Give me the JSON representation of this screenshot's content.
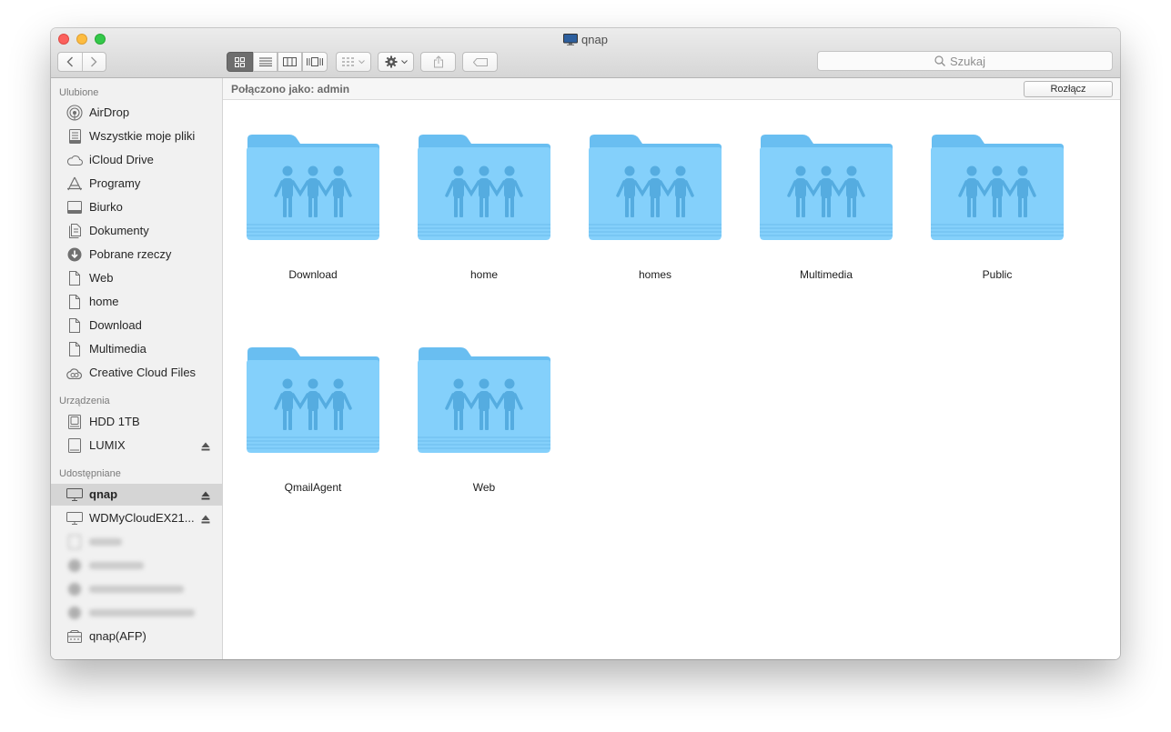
{
  "window": {
    "title": "qnap"
  },
  "toolbar": {
    "views": [
      "icon",
      "list",
      "column",
      "coverflow"
    ],
    "search_placeholder": "Szukaj"
  },
  "sidebar": {
    "sections": [
      {
        "heading": "Ulubione",
        "items": [
          {
            "label": "AirDrop",
            "icon": "airdrop-icon"
          },
          {
            "label": "Wszystkie moje pliki",
            "icon": "all-files-icon"
          },
          {
            "label": "iCloud Drive",
            "icon": "cloud-icon"
          },
          {
            "label": "Programy",
            "icon": "applications-icon"
          },
          {
            "label": "Biurko",
            "icon": "desktop-icon"
          },
          {
            "label": "Dokumenty",
            "icon": "documents-icon"
          },
          {
            "label": "Pobrane rzeczy",
            "icon": "download-icon"
          },
          {
            "label": "Web",
            "icon": "file-icon"
          },
          {
            "label": "home",
            "icon": "file-icon"
          },
          {
            "label": "Download",
            "icon": "file-icon"
          },
          {
            "label": "Multimedia",
            "icon": "file-icon"
          },
          {
            "label": "Creative Cloud Files",
            "icon": "creative-cloud-icon"
          }
        ]
      },
      {
        "heading": "Urządzenia",
        "items": [
          {
            "label": "HDD 1TB",
            "icon": "hard-drive-icon"
          },
          {
            "label": "LUMIX",
            "icon": "external-drive-icon",
            "eject": true
          }
        ]
      },
      {
        "heading": "Udostępniane",
        "items": [
          {
            "label": "qnap",
            "icon": "monitor-icon",
            "eject": true,
            "selected": true
          },
          {
            "label": "WDMyCloudEX21...",
            "icon": "monitor-icon",
            "eject": true
          },
          {
            "label": "qnap(AFP)",
            "icon": "server-icon"
          }
        ]
      }
    ]
  },
  "pathbar": {
    "connected_label": "Połączono jako: admin",
    "disconnect_label": "Rozłącz"
  },
  "folders": [
    "Download",
    "home",
    "homes",
    "Multimedia",
    "Public",
    "QmailAgent",
    "Web"
  ],
  "colors": {
    "folder_back": "#6cc3f3",
    "folder_front": "#84d1fb",
    "folder_people": "#4fa6d9",
    "selection": "#d5d5d5"
  }
}
